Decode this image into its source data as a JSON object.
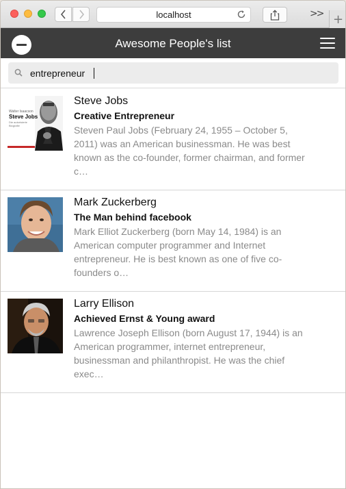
{
  "browser": {
    "url": "localhost",
    "back_icon": "chevron-left-icon",
    "forward_icon": "chevron-right-icon",
    "reload_icon": "reload-icon",
    "share_icon": "share-icon",
    "more_label": ">>",
    "new_tab_label": "+"
  },
  "app": {
    "title": "Awesome People's list",
    "menu_icon": "hamburger-icon",
    "remove_icon": "minus-circle-icon",
    "accent": "#3d3d3d"
  },
  "search": {
    "value": "entrepreneur",
    "placeholder": "",
    "icon": "search-icon"
  },
  "people": [
    {
      "name": "Steve Jobs",
      "subtitle": "Creative Entrepreneur",
      "description": "Steven Paul Jobs (February 24, 1955 – October 5, 2011) was an American businessman. He was best known as the co-founder, former chairman, and former c…",
      "thumb_caption_1": "Walter Isaacson",
      "thumb_caption_2": "Steve Jobs",
      "thumb_caption_3": "Die autorisierte Biografie"
    },
    {
      "name": "Mark Zuckerberg",
      "subtitle": "The Man behind facebook",
      "description": "Mark Elliot Zuckerberg (born May 14, 1984) is an American computer programmer and Internet entrepreneur. He is best known as one of five co-founders o…"
    },
    {
      "name": "Larry Ellison",
      "subtitle": "Achieved Ernst & Young award",
      "description": "Lawrence Joseph Ellison (born August 17, 1944) is an American programmer, internet entrepreneur, businessman and philanthropist. He was the chief exec…"
    }
  ]
}
